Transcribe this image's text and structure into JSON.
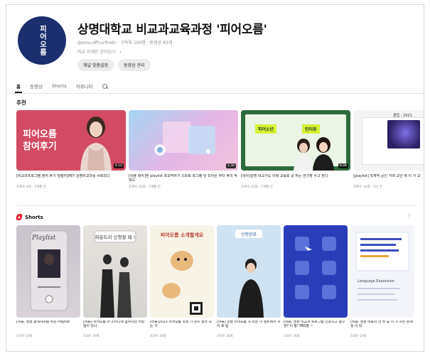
{
  "channel": {
    "title": "상명대학교 비교과교육과정 '피어오름'",
    "meta": "@smu-offcurfindic · 구독자 100명 · 동영상 83개",
    "description": "비교 이세인 강이도다",
    "more": "›",
    "avatar_text": "피어오름",
    "buttons": [
      "채널 맞춤설정",
      "동영상 관리"
    ]
  },
  "tabs": [
    "홈",
    "동영상",
    "Shorts",
    "커뮤니티"
  ],
  "sections": {
    "featured_title": "추천",
    "shorts_title": "Shorts",
    "more_menu": "⋮"
  },
  "videos": [
    {
      "thumb_text": "피어오름\n참여후기",
      "duration": "4:10",
      "title": "[비교과프로그램 참여 후기 월별자]PEY 상명비교과를 사로되다",
      "meta": "조회수 4회 · 7개월 전"
    },
    {
      "duration": "1:36",
      "title": "[비블 찾아]엔 playlist 프모막하기 스트토 로그램 당 되어온 부터 후의 적 피드",
      "meta": "조회수 22회 · 7개월 전"
    },
    {
      "thumb_label_1": "피어소년",
      "thumb_label_2": "인터뷰",
      "duration": "4:28",
      "title": "[비아]상명 비교가도 이제 교육로 갈 하는 연구할 수고 한다",
      "meta": "조회수 12회 · 7개월 전"
    },
    {
      "panel_title": "클립 - 2021",
      "title": "[playlist] 학계적 공인 거래 교안 에 이 거 교",
      "meta": "조회수 14회 · 1년 전"
    }
  ],
  "shorts": [
    {
      "thumb_text": "Playlist",
      "title": "[비블, 엔젠 송캐사마를 위한 Playlist",
      "meta": "조회수 16회"
    },
    {
      "thumb_text": "파운트리\n신청할 때 !",
      "title": "[비블] 피어오름 마 스터디에 참여하면 어떤 일이 있나",
      "meta": "조회수 29회"
    },
    {
      "thumb_text": "피어오름 소개할게요",
      "title": "[바블]2023 피어오름 학생 가 뭔지 알아 되는 거",
      "meta": "조회수 20회"
    },
    {
      "thumb_text": "신청완료",
      "title": "[비블] 상명 피어오름 사 라는 이 멘트에서 피어 로 팀",
      "meta": "조회수 26회"
    },
    {
      "title": "[비블, 엔젠 비교과 프로그램 신청하고 싶다면? 이 말! PBS편 ~",
      "meta": "조회수 26회"
    },
    {
      "thumb_text": "Language Expansion",
      "title": "[비블, 엔젠 비블의 한 위 공 시 가 하는 문제 정 이 딱",
      "meta": "조회수 19회"
    }
  ],
  "colors": {
    "avatar_bg": "#1b2f6e",
    "shorts_icon": "#e8242f",
    "accent_green": "#d7f236"
  }
}
